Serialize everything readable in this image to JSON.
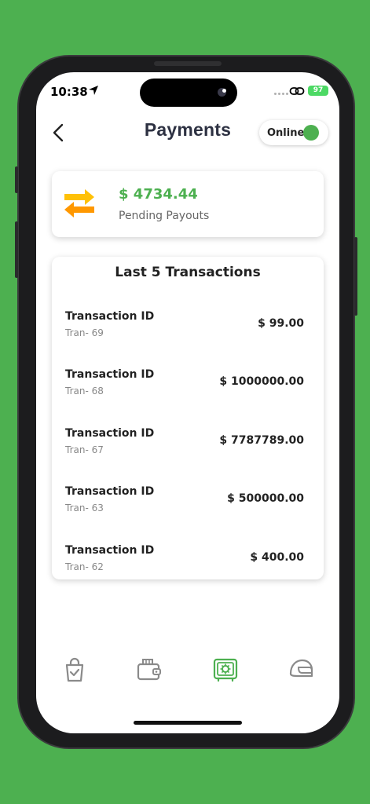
{
  "status_bar": {
    "time": "10:38",
    "battery": "97"
  },
  "header": {
    "title": "Payments",
    "online_label": "Online"
  },
  "payouts": {
    "amount": "$ 4734.44",
    "label": "Pending Payouts"
  },
  "transactions": {
    "title": "Last 5 Transactions",
    "items": [
      {
        "name": "Transaction ID",
        "id": "Tran- 69",
        "amount": "$ 99.00"
      },
      {
        "name": "Transaction ID",
        "id": "Tran- 68",
        "amount": "$ 1000000.00"
      },
      {
        "name": "Transaction ID",
        "id": "Tran- 67",
        "amount": "$ 7787789.00"
      },
      {
        "name": "Transaction ID",
        "id": "Tran- 63",
        "amount": "$ 500000.00"
      },
      {
        "name": "Transaction ID",
        "id": "Tran- 62",
        "amount": "$ 400.00"
      }
    ]
  },
  "bottom_nav": [
    {
      "icon": "shopping-bag-check-icon",
      "active": false
    },
    {
      "icon": "wallet-icon",
      "active": false
    },
    {
      "icon": "safe-icon",
      "active": true
    },
    {
      "icon": "helmet-icon",
      "active": false
    }
  ],
  "colors": {
    "accent": "#4DB050",
    "background": "#4DB050",
    "icon_inactive": "#8a8a8a",
    "arrow_yellow": "#FFC107",
    "arrow_orange": "#FF9800"
  }
}
